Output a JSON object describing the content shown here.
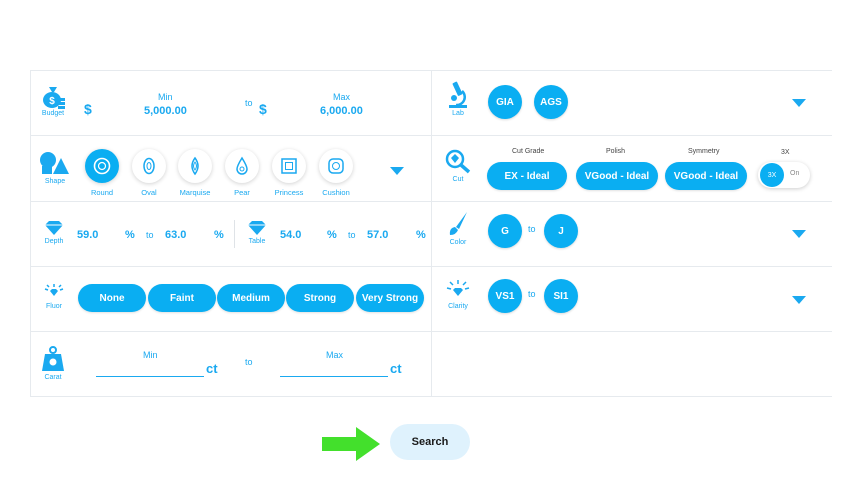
{
  "budget": {
    "label": "Budget",
    "min_label": "Min",
    "max_label": "Max",
    "currency": "$",
    "min_value": "5,000.00",
    "max_value": "6,000.00",
    "to": "to"
  },
  "lab": {
    "label": "Lab",
    "options": [
      "GIA",
      "AGS"
    ]
  },
  "shape": {
    "label": "Shape",
    "options": [
      "Round",
      "Oval",
      "Marquise",
      "Pear",
      "Princess",
      "Cushion"
    ]
  },
  "cut": {
    "label": "Cut",
    "headers": [
      "Cut Grade",
      "Polish",
      "Symmetry",
      "3X"
    ],
    "values": [
      "EX - Ideal",
      "VGood - Ideal",
      "VGood - Ideal"
    ],
    "toggle_left": "3X",
    "toggle_right": "On"
  },
  "depth": {
    "label": "Depth",
    "min": "59.0",
    "max": "63.0",
    "unit": "%",
    "to": "to"
  },
  "table": {
    "label": "Table",
    "min": "54.0",
    "max": "57.0",
    "unit": "%",
    "to": "to"
  },
  "color": {
    "label": "Color",
    "from": "G",
    "to_value": "J",
    "to": "to"
  },
  "fluor": {
    "label": "Fluor",
    "options": [
      "None",
      "Faint",
      "Medium",
      "Strong",
      "Very Strong"
    ]
  },
  "clarity": {
    "label": "Clarity",
    "from": "VS1",
    "to_value": "SI1",
    "to": "to"
  },
  "carat": {
    "label": "Carat",
    "min_label": "Min",
    "max_label": "Max",
    "unit": "ct",
    "to": "to"
  },
  "search": {
    "label": "Search"
  },
  "colors": {
    "accent": "#0aaef2",
    "arrow": "#43e02c",
    "search_bg": "#dff2fd"
  }
}
